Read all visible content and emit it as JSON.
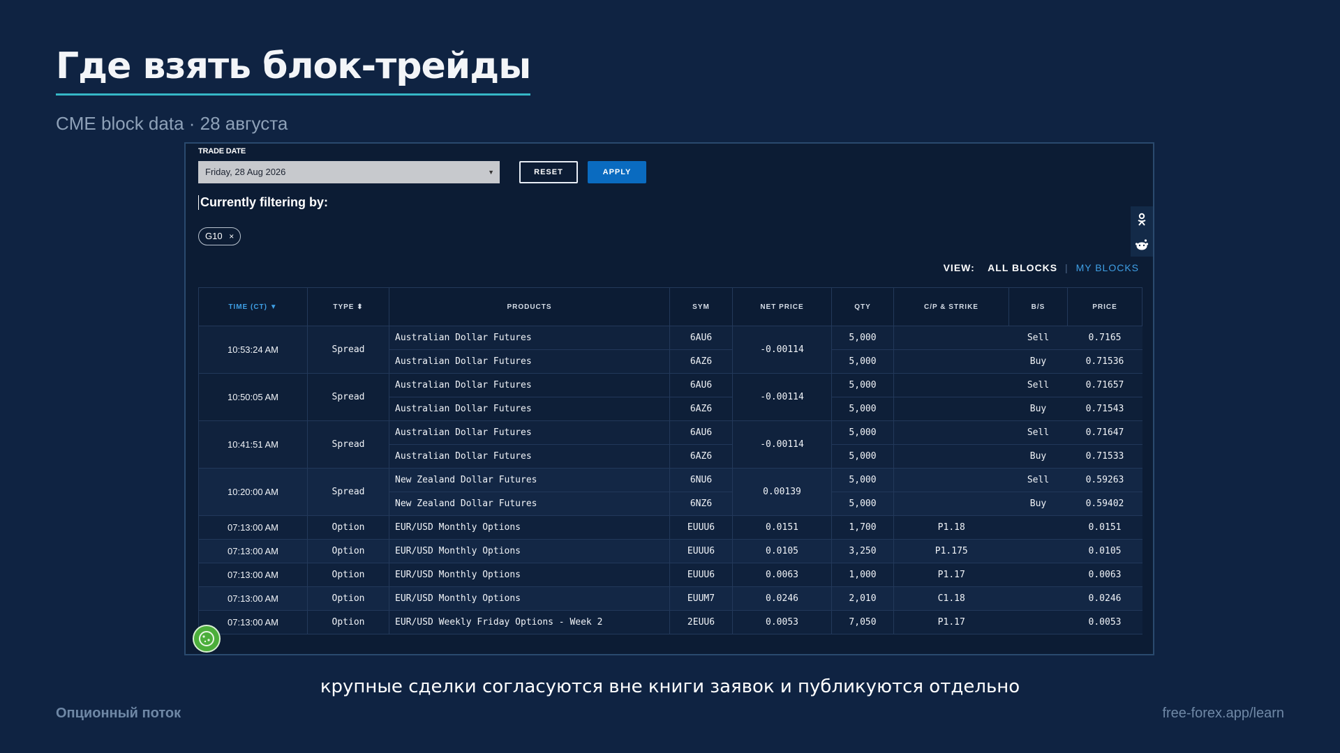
{
  "slide": {
    "title": "Где взять блок-трейды",
    "subtitle": "CME block data · 28 августа",
    "caption": "крупные сделки согласуются вне книги заявок и публикуются отдельно",
    "footer_left": "Опционный поток",
    "footer_right": "free-forex.app/learn"
  },
  "filters": {
    "trade_date_label": "TRADE DATE",
    "trade_date_value": "Friday, 28 Aug 2026",
    "reset_label": "RESET",
    "apply_label": "APPLY",
    "filtering_heading": "Currently filtering by:",
    "chip_label": "G10",
    "chip_close": "×"
  },
  "view": {
    "label": "VIEW:",
    "all_blocks": "ALL BLOCKS",
    "separator": "|",
    "my_blocks": "MY BLOCKS"
  },
  "share_icons": [
    "odnoklassniki-icon",
    "reddit-icon"
  ],
  "table": {
    "headers": {
      "time": "TIME (CT)",
      "type": "TYPE",
      "products": "PRODUCTS",
      "sym": "SYM",
      "net_price": "NET PRICE",
      "qty": "QTY",
      "cp_strike": "C/P & STRIKE",
      "bs": "B/S",
      "price": "PRICE"
    },
    "spreads": [
      {
        "time": "10:53:24 AM",
        "type": "Spread",
        "net_price": "-0.00114",
        "legs": [
          {
            "product": "Australian Dollar Futures",
            "sym": "6AU6",
            "qty": "5,000",
            "cp": "",
            "bs": "Sell",
            "price": "0.7165"
          },
          {
            "product": "Australian Dollar Futures",
            "sym": "6AZ6",
            "qty": "5,000",
            "cp": "",
            "bs": "Buy",
            "price": "0.71536"
          }
        ]
      },
      {
        "time": "10:50:05 AM",
        "type": "Spread",
        "net_price": "-0.00114",
        "legs": [
          {
            "product": "Australian Dollar Futures",
            "sym": "6AU6",
            "qty": "5,000",
            "cp": "",
            "bs": "Sell",
            "price": "0.71657"
          },
          {
            "product": "Australian Dollar Futures",
            "sym": "6AZ6",
            "qty": "5,000",
            "cp": "",
            "bs": "Buy",
            "price": "0.71543"
          }
        ]
      },
      {
        "time": "10:41:51 AM",
        "type": "Spread",
        "net_price": "-0.00114",
        "legs": [
          {
            "product": "Australian Dollar Futures",
            "sym": "6AU6",
            "qty": "5,000",
            "cp": "",
            "bs": "Sell",
            "price": "0.71647"
          },
          {
            "product": "Australian Dollar Futures",
            "sym": "6AZ6",
            "qty": "5,000",
            "cp": "",
            "bs": "Buy",
            "price": "0.71533"
          }
        ]
      },
      {
        "time": "10:20:00 AM",
        "type": "Spread",
        "net_price": "0.00139",
        "legs": [
          {
            "product": "New Zealand Dollar Futures",
            "sym": "6NU6",
            "qty": "5,000",
            "cp": "",
            "bs": "Sell",
            "price": "0.59263"
          },
          {
            "product": "New Zealand Dollar Futures",
            "sym": "6NZ6",
            "qty": "5,000",
            "cp": "",
            "bs": "Buy",
            "price": "0.59402"
          }
        ]
      }
    ],
    "options": [
      {
        "time": "07:13:00 AM",
        "type": "Option",
        "product": "EUR/USD Monthly Options",
        "sym": "EUUU6",
        "net_price": "0.0151",
        "qty": "1,700",
        "cp": "P1.18",
        "bs": "",
        "price": "0.0151"
      },
      {
        "time": "07:13:00 AM",
        "type": "Option",
        "product": "EUR/USD Monthly Options",
        "sym": "EUUU6",
        "net_price": "0.0105",
        "qty": "3,250",
        "cp": "P1.175",
        "bs": "",
        "price": "0.0105"
      },
      {
        "time": "07:13:00 AM",
        "type": "Option",
        "product": "EUR/USD Monthly Options",
        "sym": "EUUU6",
        "net_price": "0.0063",
        "qty": "1,000",
        "cp": "P1.17",
        "bs": "",
        "price": "0.0063"
      },
      {
        "time": "07:13:00 AM",
        "type": "Option",
        "product": "EUR/USD Monthly Options",
        "sym": "EUUM7",
        "net_price": "0.0246",
        "qty": "2,010",
        "cp": "C1.18",
        "bs": "",
        "price": "0.0246"
      },
      {
        "time": "07:13:00 AM",
        "type": "Option",
        "product": "EUR/USD Weekly Friday Options - Week 2",
        "sym": "2EUU6",
        "net_price": "0.0053",
        "qty": "7,050",
        "cp": "P1.17",
        "bs": "",
        "price": "0.0053"
      }
    ]
  },
  "colors": {
    "background": "#0f2342",
    "accent_underline": "#35b7c6",
    "link_blue": "#3fa0e6",
    "apply_button": "#0a6bc0",
    "cookie_badge": "#4cae3b"
  }
}
